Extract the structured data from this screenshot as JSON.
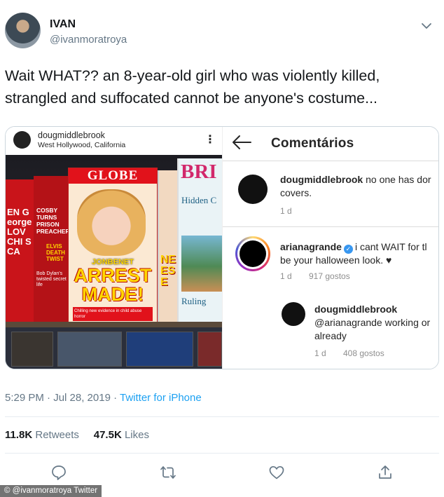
{
  "user": {
    "display_name": "IVAN",
    "handle": "@ivanmoratroya"
  },
  "tweet": {
    "text_line1": "Wait WHAT?? an 8-year-old girl who was violently killed,",
    "text_line2": "strangled and suffocated cannot be anyone's costume..."
  },
  "instagram_post": {
    "username": "dougmiddlebrook",
    "location": "West Hollywood, California",
    "magazines": {
      "globe_masthead": "GLOBE",
      "globe_name": "JONBENET",
      "globe_headline_1": "ARREST",
      "globe_headline_2": "MADE!",
      "globe_footer": "Chilling new evidence in child abuse horror",
      "cosby_text": "COSBY TURNS PRISON PREACHER!",
      "cosby_sub": "ELVIS DEATH TWIST",
      "cosby_bob": "Bob Dylan's twisted secret life",
      "left_mag_text": "EN George LOV CHI SCA",
      "mid_mag_text": "NE ES E",
      "bri_masthead": "BRI",
      "bri_line1": "Hidden C",
      "bri_line2": "Ruling"
    }
  },
  "comments_panel": {
    "title": "Comentários",
    "comments": [
      {
        "username": "dougmiddlebrook",
        "text_line1": "no one has dor",
        "text_line2": "covers.",
        "age": "1 d",
        "likes": ""
      },
      {
        "username": "arianagrande",
        "text_line1": "i cant WAIT for tl",
        "text_line2": "be your halloween look. ♥",
        "age": "1 d",
        "likes": "917 gostos"
      },
      {
        "username": "dougmiddlebrook",
        "text_line1": "@arianagrande working or",
        "text_line2": "already",
        "age": "1 d",
        "likes": "408 gostos"
      }
    ]
  },
  "meta": {
    "time": "5:29 PM · Jul 28, 2019 · ",
    "source": "Twitter for iPhone"
  },
  "stats": {
    "retweets_count": "11.8K",
    "retweets_label": "Retweets",
    "likes_count": "47.5K",
    "likes_label": "Likes"
  },
  "actions": {
    "reply_icon": "reply-icon",
    "retweet_icon": "retweet-icon",
    "like_icon": "heart-icon",
    "share_icon": "share-icon"
  },
  "watermark": "© @ivanmoratroya Twitter",
  "colors": {
    "link": "#1da1f2",
    "secondary_text": "#657786",
    "verified": "#3897f0"
  }
}
